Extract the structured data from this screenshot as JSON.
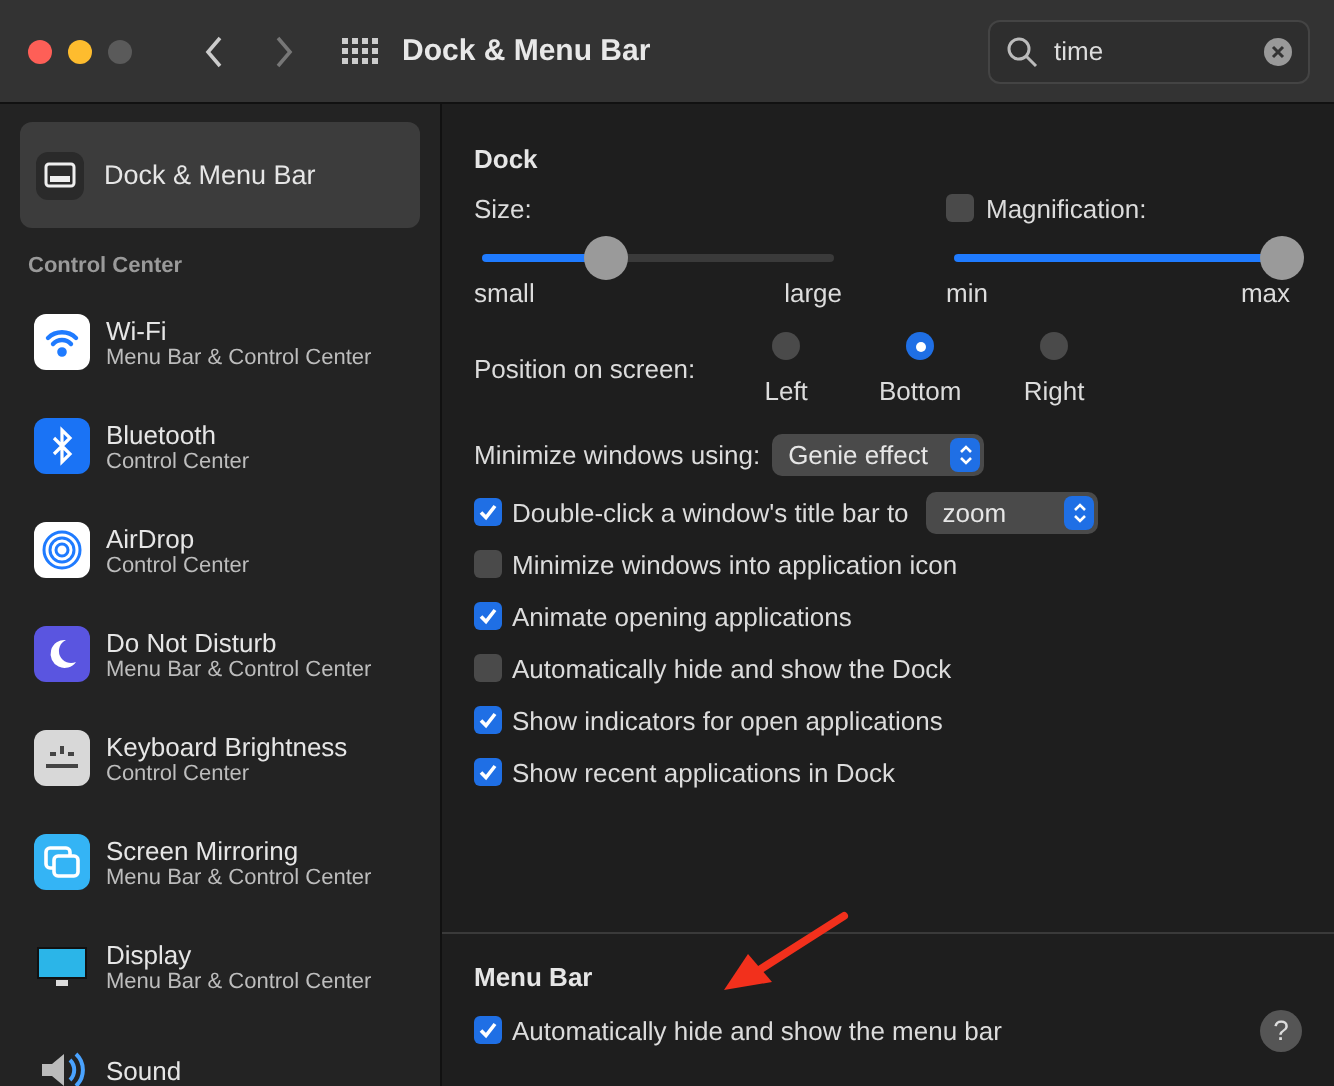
{
  "window": {
    "title": "Dock & Menu Bar",
    "search": {
      "value": "time"
    }
  },
  "sidebar": {
    "selected_item": {
      "label": "Dock & Menu Bar",
      "selected": true
    },
    "section": "Control Center",
    "items": [
      {
        "kind": "wifi",
        "title": "Wi-Fi",
        "subtitle": "Menu Bar & Control Center",
        "selected": false
      },
      {
        "kind": "bluetooth",
        "title": "Bluetooth",
        "subtitle": "Control Center",
        "selected": false
      },
      {
        "kind": "airdrop",
        "title": "AirDrop",
        "subtitle": "Control Center",
        "selected": false
      },
      {
        "kind": "moon",
        "title": "Do Not Disturb",
        "subtitle": "Menu Bar & Control Center",
        "selected": false
      },
      {
        "kind": "keyboard",
        "title": "Keyboard Brightness",
        "subtitle": "Control Center",
        "selected": false
      },
      {
        "kind": "mirroring",
        "title": "Screen Mirroring",
        "subtitle": "Menu Bar & Control Center",
        "selected": false
      },
      {
        "kind": "display",
        "title": "Display",
        "subtitle": "Menu Bar & Control Center",
        "selected": false
      },
      {
        "kind": "sound",
        "title": "Sound",
        "selected": false
      }
    ]
  },
  "dock": {
    "title": "Dock",
    "size": {
      "label": "Size:",
      "level": 0.35,
      "min": "small",
      "max": "large"
    },
    "magnification": {
      "label": "Magnification:",
      "checked": false,
      "level": 1,
      "min": "min",
      "max": "max"
    },
    "position": {
      "label": "Position on screen:",
      "options": [
        {
          "label": "Left",
          "selected": false
        },
        {
          "label": "Bottom",
          "selected": true
        },
        {
          "label": "Right",
          "selected": false
        }
      ]
    },
    "minimize": {
      "label": "Minimize windows using:",
      "value": "Genie effect"
    },
    "checkboxes": [
      {
        "label": "Double-click a window's title bar to",
        "checked": true,
        "dropdown": "zoom"
      },
      {
        "label": "Minimize windows into application icon",
        "checked": false
      },
      {
        "label": "Animate opening applications",
        "checked": true
      },
      {
        "label": "Automatically hide and show the Dock",
        "checked": false
      },
      {
        "label": "Show indicators for open applications",
        "checked": true
      },
      {
        "label": "Show recent applications in Dock",
        "checked": true
      }
    ]
  },
  "menu_bar": {
    "title": "Menu Bar",
    "checkboxes": [
      {
        "label": "Automatically hide and show the menu bar",
        "checked": true
      }
    ],
    "help": "?"
  }
}
